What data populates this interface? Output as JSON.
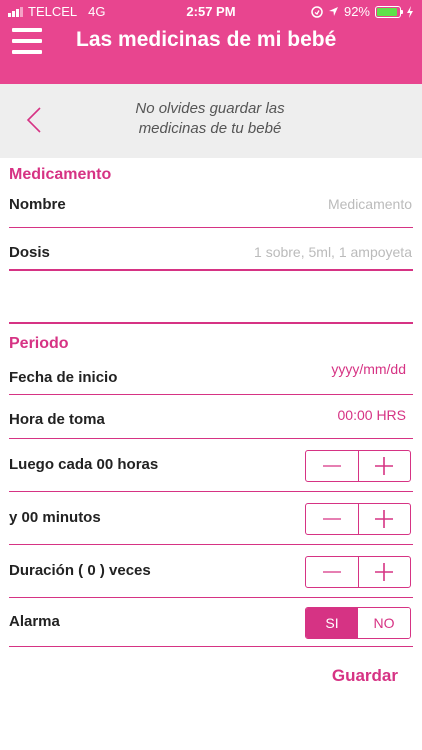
{
  "status_bar": {
    "carrier": "TELCEL",
    "network": "4G",
    "time": "2:57 PM",
    "battery": "92%",
    "battery_level": 0.92
  },
  "header": {
    "title": "Las medicinas de mi bebé"
  },
  "subheader": {
    "line1": "No olvides guardar las",
    "line2": "medicinas de tu bebé"
  },
  "medicamento": {
    "section_title": "Medicamento",
    "nombre_label": "Nombre",
    "nombre_placeholder": "Medicamento",
    "dosis_label": "Dosis",
    "dosis_placeholder": "1 sobre,  5ml, 1 ampoyeta"
  },
  "periodo": {
    "section_title": "Periodo",
    "fecha_label": "Fecha de inicio",
    "fecha_value": "yyyy/mm/dd",
    "hora_label": "Hora de toma",
    "hora_value": "00:00 HRS",
    "cada_label": "Luego cada 00 horas",
    "minutos_label": "y 00 minutos",
    "duracion_label": "Duración ( 0 ) veces",
    "alarma_label": "Alarma",
    "alarma_on": "SI",
    "alarma_off": "NO"
  },
  "actions": {
    "save": "Guardar"
  },
  "colors": {
    "brand": "#e8458f",
    "accent": "#d63384"
  }
}
